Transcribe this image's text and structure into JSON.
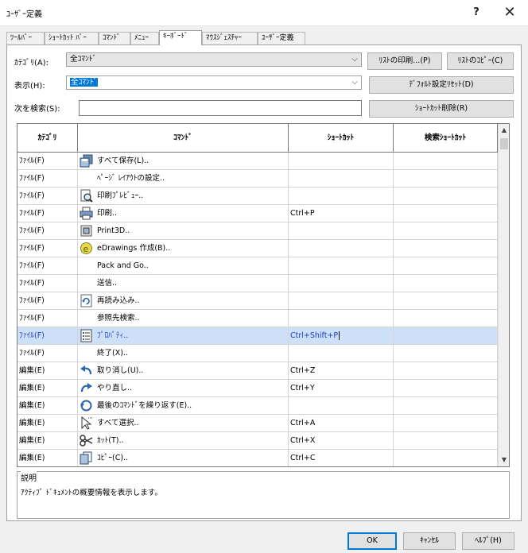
{
  "window": {
    "title": "ﾕｰｻﾞｰ定義",
    "help": "?",
    "close": "✕"
  },
  "tabs": [
    {
      "label": "ﾂｰﾙﾊﾞｰ"
    },
    {
      "label": "ｼｮｰﾄｶｯﾄ ﾊﾞｰ"
    },
    {
      "label": "ｺﾏﾝﾄﾞ"
    },
    {
      "label": "ﾒﾆｭｰ"
    },
    {
      "label": "ｷｰﾎﾞｰﾄﾞ"
    },
    {
      "label": "ﾏｳｽｼﾞｪｽﾁｬｰ"
    },
    {
      "label": "ﾕｰｻﾞｰ定義"
    }
  ],
  "active_tab": "ｷｰﾎﾞｰﾄﾞ",
  "filters": {
    "category_label": "ｶﾃｺﾞﾘ(A):",
    "category_value": "全ｺﾏﾝﾄﾞ",
    "show_label": "表示(H):",
    "show_value": "全ｺﾏﾝﾄﾞ",
    "search_label": "次を検索(S):",
    "search_value": ""
  },
  "buttons": {
    "print_list": "ﾘｽﾄの印刷...(P)",
    "copy_list": "ﾘｽﾄのｺﾋﾟｰ(C)",
    "reset_default": "ﾃﾞﾌｫﾙﾄ設定ﾘｾｯﾄ(D)",
    "delete_shortcut": "ｼｮｰﾄｶｯﾄ削除(R)"
  },
  "table": {
    "headers": [
      "ｶﾃｺﾞﾘ",
      "ｺﾏﾝﾄﾞ",
      "ｼｮｰﾄｶｯﾄ",
      "検索ｼｮｰﾄｶｯﾄ"
    ],
    "rows": [
      {
        "category": "ﾌｧｲﾙ(F)",
        "command": "すべて保存(L)..",
        "shortcut": "",
        "search": "",
        "icon": "save-all-icon"
      },
      {
        "category": "ﾌｧｲﾙ(F)",
        "command": "ﾍﾟｰｼﾞ ﾚｲｱｳﾄの設定..",
        "shortcut": "",
        "search": "",
        "icon": ""
      },
      {
        "category": "ﾌｧｲﾙ(F)",
        "command": "印刷ﾌﾟﾚﾋﾞｭｰ..",
        "shortcut": "",
        "search": "",
        "icon": "print-preview-icon"
      },
      {
        "category": "ﾌｧｲﾙ(F)",
        "command": "印刷..",
        "shortcut": "Ctrl+P",
        "search": "",
        "icon": "printer-icon"
      },
      {
        "category": "ﾌｧｲﾙ(F)",
        "command": "Print3D..",
        "shortcut": "",
        "search": "",
        "icon": "print3d-icon"
      },
      {
        "category": "ﾌｧｲﾙ(F)",
        "command": "eDrawings 作成(B)..",
        "shortcut": "",
        "search": "",
        "icon": "edrawings-icon"
      },
      {
        "category": "ﾌｧｲﾙ(F)",
        "command": "Pack and Go..",
        "shortcut": "",
        "search": "",
        "icon": "pack-and-go-icon"
      },
      {
        "category": "ﾌｧｲﾙ(F)",
        "command": "送信..",
        "shortcut": "",
        "search": "",
        "icon": ""
      },
      {
        "category": "ﾌｧｲﾙ(F)",
        "command": "再読み込み..",
        "shortcut": "",
        "search": "",
        "icon": "reload-icon"
      },
      {
        "category": "ﾌｧｲﾙ(F)",
        "command": "参照先検索..",
        "shortcut": "",
        "search": "",
        "icon": ""
      },
      {
        "category": "ﾌｧｲﾙ(F)",
        "command": "ﾌﾟﾛﾊﾟﾃｨ..",
        "shortcut": "Ctrl+Shift+P",
        "search": "",
        "icon": "properties-icon",
        "selected": true
      },
      {
        "category": "ﾌｧｲﾙ(F)",
        "command": "終了(X)..",
        "shortcut": "",
        "search": "",
        "icon": ""
      },
      {
        "category": "編集(E)",
        "command": "取り消し(U)..",
        "shortcut": "Ctrl+Z",
        "search": "",
        "icon": "undo-icon"
      },
      {
        "category": "編集(E)",
        "command": "やり直し..",
        "shortcut": "Ctrl+Y",
        "search": "",
        "icon": "redo-icon"
      },
      {
        "category": "編集(E)",
        "command": "最後のｺﾏﾝﾄﾞを繰り返す(E)..",
        "shortcut": "",
        "search": "",
        "icon": "repeat-icon"
      },
      {
        "category": "編集(E)",
        "command": "すべて選択..",
        "shortcut": "Ctrl+A",
        "search": "",
        "icon": "select-all-icon"
      },
      {
        "category": "編集(E)",
        "command": "ｶｯﾄ(T)..",
        "shortcut": "Ctrl+X",
        "search": "",
        "icon": "scissors-icon"
      },
      {
        "category": "編集(E)",
        "command": "ｺﾋﾟｰ(C)..",
        "shortcut": "Ctrl+C",
        "search": "",
        "icon": "copy-icon"
      }
    ]
  },
  "description": {
    "title": "説明",
    "text": "ｱｸﾃｨﾌﾞ ﾄﾞｷｭﾒﾝﾄの概要情報を表示します。"
  },
  "footer": {
    "ok": "OK",
    "cancel": "ｷｬﾝｾﾙ",
    "help": "ﾍﾙﾌﾟ(H)"
  },
  "colors": {
    "accent": "#0078d7",
    "selected_row": "#cde0f7"
  }
}
